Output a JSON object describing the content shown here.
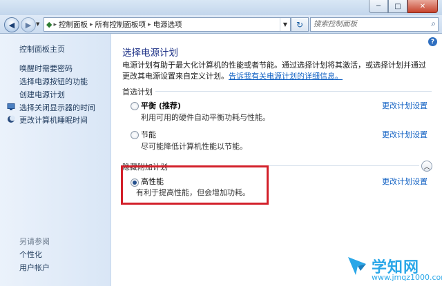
{
  "window": {
    "min_label": "─",
    "max_label": "□",
    "close_label": "✕"
  },
  "nav": {
    "back_icon": "back-arrow-icon",
    "forward_icon": "forward-arrow-icon",
    "breadcrumbs": [
      "控制面板",
      "所有控制面板项",
      "电源选项"
    ],
    "search_placeholder": "搜索控制面板"
  },
  "sidebar": {
    "home": "控制面板主页",
    "items": [
      {
        "label": "唤醒时需要密码"
      },
      {
        "label": "选择电源按钮的功能"
      },
      {
        "label": "创建电源计划"
      },
      {
        "label": "选择关闭显示器的时间",
        "icon": "monitor-icon"
      },
      {
        "label": "更改计算机睡眠时间",
        "icon": "moon-icon"
      }
    ],
    "see_also": "另请参阅",
    "see_also_items": [
      "个性化",
      "用户帐户"
    ]
  },
  "main": {
    "title": "选择电源计划",
    "description": "电源计划有助于最大化计算机的性能或者节能。通过选择计划将其激活，或选择计划并通过更改其电源设置来自定义计划。",
    "learn_more": "告诉我有关电源计划的详细信息。",
    "preferred_group": "首选计划",
    "hidden_group": "隐藏附加计划",
    "plans": [
      {
        "name": "平衡 (推荐)",
        "desc": "利用可用的硬件自动平衡功耗与性能。",
        "link": "更改计划设置",
        "selected": false
      },
      {
        "name": "节能",
        "desc": "尽可能降低计算机性能以节能。",
        "link": "更改计划设置",
        "selected": false
      },
      {
        "name": "高性能",
        "desc": "有利于提高性能，但会增加功耗。",
        "link": "更改计划设置",
        "selected": true
      }
    ]
  },
  "watermark": {
    "text": "学知网",
    "url": "www.jmqz1000.com",
    "accent": "#2aa7e8"
  },
  "colors": {
    "heading": "#1e3287",
    "link": "#1463c4",
    "highlight": "#d3202a"
  }
}
